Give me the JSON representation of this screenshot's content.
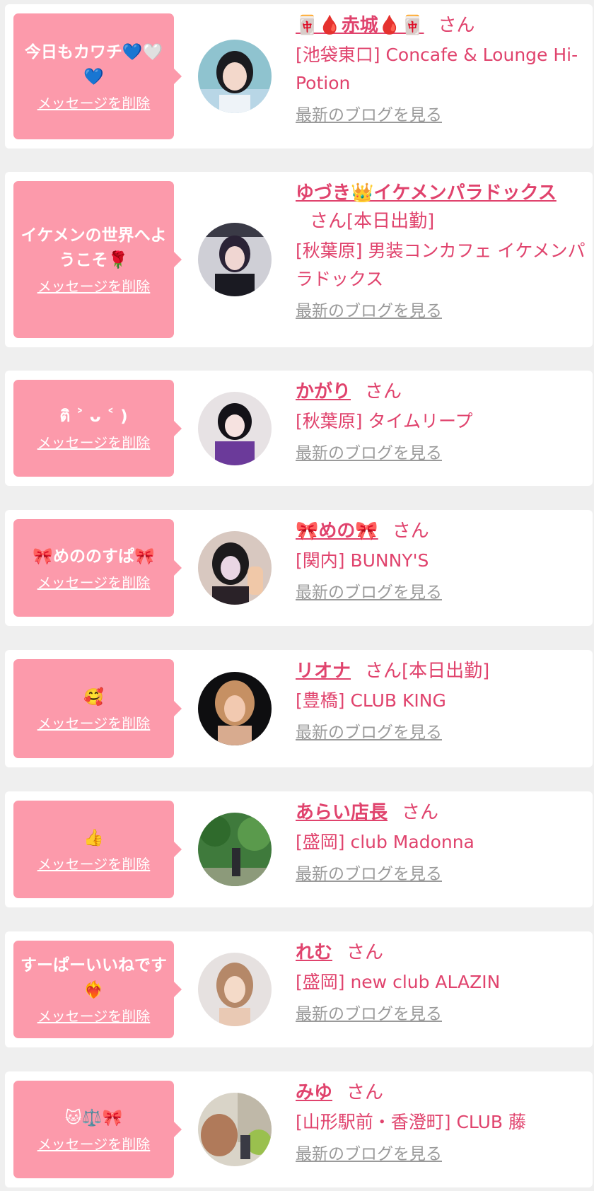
{
  "delete_label": "メッセージを削除",
  "blog_label": "最新のブログを見る",
  "san_label": "さん",
  "colors": {
    "accent": "#e0436d",
    "bubble": "#fc9aab",
    "link_gray": "#9a9a9a",
    "background": "#efefef"
  },
  "items": [
    {
      "message": "今日もカワチ💙🤍💙",
      "name": "🀄🩸赤城🩸🀄",
      "status": "",
      "shop": "[池袋東口] Concafe & Lounge Hi-Potion"
    },
    {
      "message": "イケメンの世界へようこそ🌹",
      "name": "ゆづき👑イケメンパラドックス",
      "status": "[本日出勤]",
      "shop": "[秋葉原] 男装コンカフェ イケメンパラドックス"
    },
    {
      "message": "ติ ˃ ᴗ ˂ )",
      "name": "かがり",
      "status": "",
      "shop": "[秋葉原] タイムリープ"
    },
    {
      "message": "🎀めののすぱ🎀",
      "name": "🎀めの🎀",
      "status": "",
      "shop": "[関内] BUNNY'S"
    },
    {
      "message": "🥰",
      "name": "リオナ",
      "status": "[本日出勤]",
      "shop": "[豊橋] CLUB KING"
    },
    {
      "message": "👍",
      "name": "あらい店長",
      "status": "",
      "shop": "[盛岡] club Madonna"
    },
    {
      "message": "すーぱーいいねです❤️‍🔥",
      "name": "れむ",
      "status": "",
      "shop": "[盛岡] new club ALAZIN"
    },
    {
      "message": "🐱⚖️🎀",
      "name": "みゆ",
      "status": "",
      "shop": "[山形駅前・香澄町] CLUB 藤"
    }
  ]
}
